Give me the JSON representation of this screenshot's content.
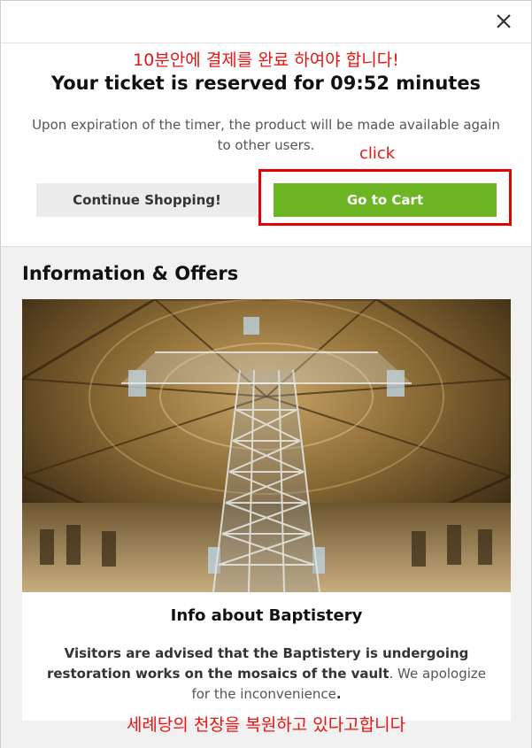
{
  "annotations": {
    "top_note": "10분안에 결제를 완료 하여야 합니다!",
    "click_note": "click",
    "bottom_note": "세례당의 천장을 복원하고 있다고합니다",
    "color": "#e81414"
  },
  "dialog": {
    "close_icon": "close-icon",
    "title": "Your ticket is reserved for 09:52 minutes",
    "subtitle": "Upon expiration of the timer, the product will be made available again to other users.",
    "continue_label": "Continue Shopping!",
    "cart_label": "Go to Cart",
    "cart_color": "#6cb523"
  },
  "offers": {
    "heading": "Information & Offers",
    "image_alt": "Baptistery dome interior with restoration scaffolding",
    "card_title": "Info about Baptistery",
    "body_bold": "Visitors are advised that the Baptistery is undergoing restoration works on the mosaics of the vault",
    "body_rest": ". We apologize for the inconvenience",
    "body_end": "."
  }
}
